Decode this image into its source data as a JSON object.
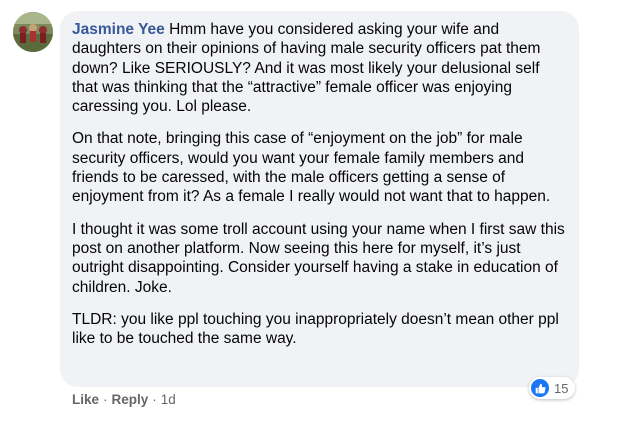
{
  "comment": {
    "author": "Jasmine Yee",
    "paragraphs": [
      "Hmm have you considered asking your wife and daughters on their opinions of having male security officers pat them down? Like SERIOUSLY? And it was most likely your delusional self that was thinking that the “attractive” female officer was enjoying caressing you. Lol please.",
      "On that note, bringing this case of “enjoyment on the job” for male security officers, would you want your female family members and friends to be caressed, with the male officers getting a sense of enjoyment from it? As a female I really would not want that to happen.",
      "I thought it was some troll account using your name when I first saw this post on another platform. Now seeing this here for myself, it’s just outright disappointing. Consider yourself having a stake in education of children. Joke.",
      "TLDR: you like ppl touching you inappropriately doesn’t mean other ppl like to be touched the same way."
    ],
    "reaction_count": "15",
    "reaction_icon": "thumbs-up-icon",
    "accent_color": "#1877f2"
  },
  "actions": {
    "like_label": "Like",
    "reply_label": "Reply",
    "separator": "·",
    "timestamp": "1d"
  }
}
